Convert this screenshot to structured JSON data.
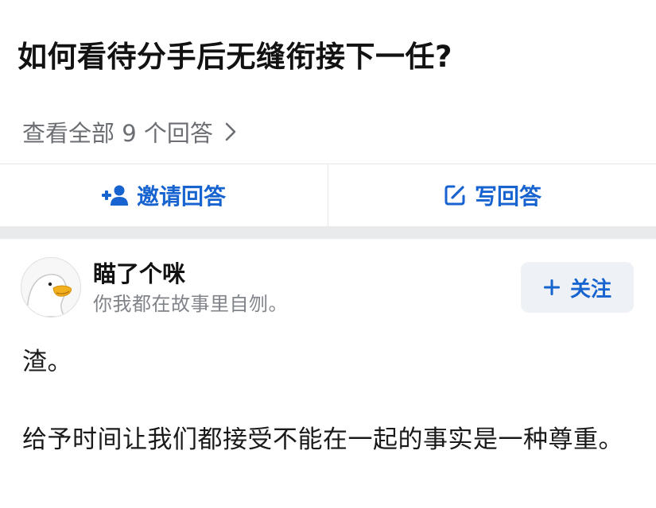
{
  "question": {
    "title": "如何看待分手后无缝衔接下一任?"
  },
  "answers_link": {
    "label": "查看全部 9 个回答"
  },
  "actions": {
    "invite_label": "邀请回答",
    "write_label": "写回答"
  },
  "author": {
    "name": "瞄了个咪",
    "bio": "你我都在故事里自刎。",
    "follow_label": "关注"
  },
  "answer": {
    "paragraphs": [
      "渣。",
      "给予时间让我们都接受不能在一起的事实是一种尊重。"
    ]
  },
  "colors": {
    "accent": "#1763d0",
    "muted_text": "#6b6e73",
    "divider": "#e6e7e9",
    "follow_bg": "#eef1f5"
  },
  "icons": {
    "chevron": "chevron-right-icon",
    "invite": "add-user-icon",
    "write": "edit-icon",
    "follow": "plus-icon",
    "avatar": "goose-avatar"
  }
}
